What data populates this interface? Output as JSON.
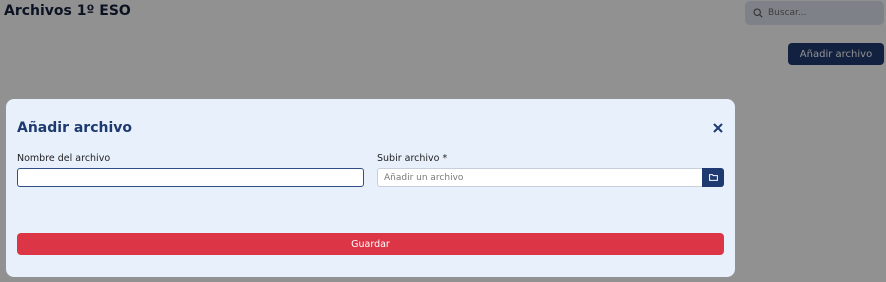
{
  "page": {
    "title": "Archivos 1º ESO",
    "search_placeholder": "Buscar...",
    "add_button_label": "Añadir archivo"
  },
  "modal": {
    "title": "Añadir archivo",
    "close_icon": "close-icon",
    "name_label": "Nombre del archivo",
    "name_value": "",
    "upload_label": "Subir archivo *",
    "upload_placeholder": "Añadir un archivo",
    "folder_icon": "folder-icon",
    "save_label": "Guardar"
  },
  "colors": {
    "primary": "#1e3a70",
    "danger": "#dc3545",
    "modal_bg": "#e7f0fb"
  }
}
